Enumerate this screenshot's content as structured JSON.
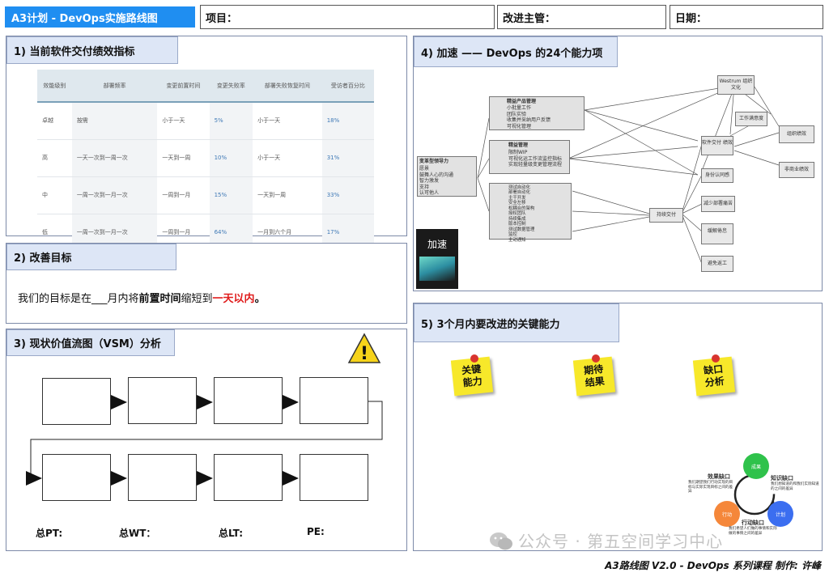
{
  "header": {
    "title": "A3计划 - DevOps实施路线图",
    "project_label": "项目：",
    "manager_label": "改进主管：",
    "date_label": "日期："
  },
  "sec1": {
    "title": "1) 当前软件交付绩效指标",
    "columns": [
      "效能级别",
      "部署频率",
      "变更前置时间",
      "变更失败率",
      "部署失败恢复时间",
      "受访者百分比"
    ],
    "rows": [
      [
        "卓越",
        "按需",
        "小于一天",
        "5%",
        "小于一天",
        "18%"
      ],
      [
        "高",
        "一天一次到一周一次",
        "一天到一周",
        "10%",
        "小于一天",
        "31%"
      ],
      [
        "中",
        "一周一次到一月一次",
        "一周到一月",
        "15%",
        "一天到一周",
        "33%"
      ],
      [
        "低",
        "一周一次到一月一次",
        "一周到一月",
        "64%",
        "一月到六个月",
        "17%"
      ]
    ]
  },
  "sec2": {
    "title": "2) 改善目标",
    "goal_a": "我们的目标是在___月内将",
    "goal_b": "前置时间",
    "goal_c": "缩短到",
    "goal_d": "一天以内",
    "goal_e": "。"
  },
  "sec3": {
    "title": "3) 现状价值流图（VSM）分析",
    "warning_glyph": "!",
    "totals": [
      "总PT:",
      "总WT：",
      "总LT:",
      "PE:"
    ]
  },
  "sec4": {
    "title": "4) 加速 —— DevOps 的24个能力项",
    "root_title": "变革型领导力",
    "root_items": [
      "愿景",
      "鼓舞人心的沟通",
      "智力激发",
      "支持",
      "认可他人"
    ],
    "product_title": "精益产品管理",
    "product_items": [
      "小批量工作",
      "团队实验",
      "收集并采纳用户反馈",
      "可视化管理"
    ],
    "lean_title": "精益管理",
    "lean_items": [
      "限制WIP",
      "可视化运工作流监控指标",
      "实现轻量级变更管理流程"
    ],
    "tech_items": [
      "测试自动化",
      "部署自动化",
      "主干开发",
      "安全左移",
      "松耦合的架构",
      "授权团队",
      "持续集成",
      "版本控制",
      "测试数据管理",
      "监控",
      "主动通知"
    ],
    "continuous_delivery": "持续交付",
    "westrum": "Westrum 组织文化",
    "workflow": "工作满意度",
    "software_delivery": "软件交付 绩效",
    "org_perf": "组织绩效",
    "non_commercial": "非商业绩效",
    "identity": "身份认同感",
    "less_pain": "减少部署痛苦",
    "less_burnout": "缓解倦怠",
    "less_rework": "避免返工",
    "book_title": "加速"
  },
  "sec5": {
    "title": "5) 3个月内要改进的关键能力",
    "notes": [
      "关键能力",
      "期待结果",
      "缺口分析"
    ],
    "cycle_labels": [
      "成果",
      "行动",
      "计划"
    ],
    "gap1_title": "效果缺口",
    "gap1_text": "我们期望我们行动实现的目标与实际实现目标之间的差异",
    "gap2_title": "知识缺口",
    "gap2_text": "我们想知道的和我们实际知道的之间的差异",
    "gap3_title": "行动缺口",
    "gap3_text": "我们希望人们做的事情和实际做的事情之间的差异"
  },
  "footer": {
    "credit": "A3路线图 V2.0 - DevOps 系列课程 制作: 许峰",
    "watermark": "公众号 · 第五空间学习中心"
  },
  "colors": {
    "header_blue": "#1f8ef1",
    "section_bg": "#dde6f6",
    "sticky": "#f7e82a",
    "goal_red": "#e01b1b",
    "cycle_green": "#2fc24b",
    "cycle_orange": "#f5873a",
    "cycle_blue": "#3b6ef0"
  }
}
